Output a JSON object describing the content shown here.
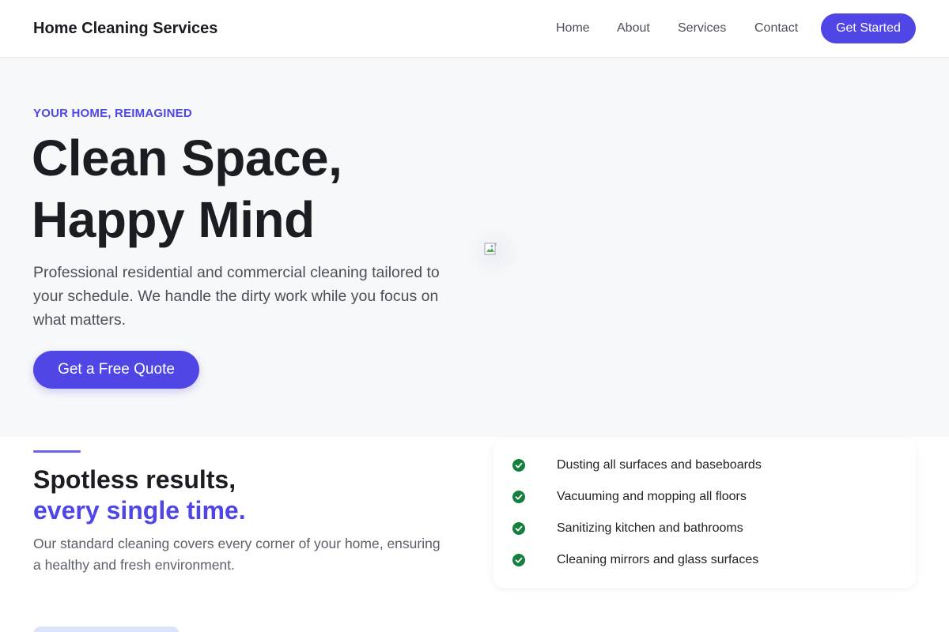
{
  "header": {
    "brand": "Home Cleaning Services",
    "nav": [
      "Home",
      "About",
      "Services",
      "Contact"
    ],
    "cta": "Get Started"
  },
  "hero": {
    "eyebrow": "YOUR HOME, REIMAGINED",
    "title_line1": "Clean Space,",
    "title_line2": "Happy Mind",
    "description": "Professional residential and commercial cleaning tailored to your schedule. We handle the dirty work while you focus on what matters.",
    "cta": "Get a Free Quote",
    "image_icon": "broken-image-icon"
  },
  "features": {
    "title_line1": "Spotless results,",
    "title_line2": "every single time.",
    "description": "Our standard cleaning covers every corner of your home, ensuring a healthy and fresh environment.",
    "checklist": [
      "Dusting all surfaces and baseboards",
      "Vacuuming and mopping all floors",
      "Sanitizing kitchen and bathrooms",
      "Cleaning mirrors and glass surfaces"
    ],
    "check_icon": "check-circle-icon"
  },
  "colors": {
    "accent": "#4f46e5",
    "check": "#15803d",
    "hero_bg": "#f7f8fa"
  }
}
